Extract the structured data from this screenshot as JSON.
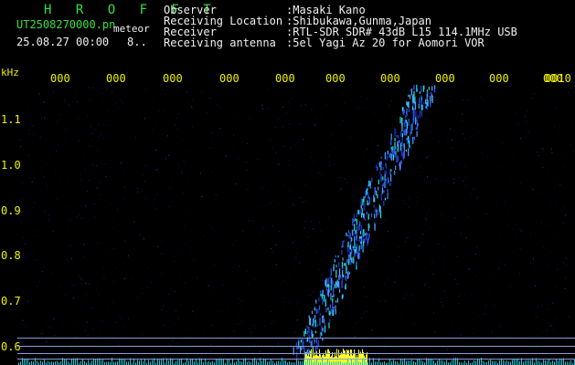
{
  "header": {
    "app_title": "H R O F F T",
    "filename": "UT2508270000.pn",
    "tag": "meteor",
    "datetime": "25.08.27 00:00",
    "counter": "8..",
    "fields": [
      {
        "label": "Observer",
        "value": ":Masaki Kano"
      },
      {
        "label": "Receiving Location",
        "value": ":Shibukawa,Gunma,Japan"
      },
      {
        "label": "Receiver",
        "value": ":RTL-SDR SDR# 43dB L15 114.1MHz USB"
      },
      {
        "label": "Receiving antenna",
        "value": ":5el Yagi Az 20 for Aomori VOR"
      }
    ]
  },
  "axes": {
    "y_unit": "kHz",
    "y_ticks": [
      "1.1",
      "1.0",
      "0.9",
      "0.8",
      "0.7",
      "0.6"
    ],
    "x_ticks": [
      "000",
      "000",
      "000",
      "000",
      "000",
      "000",
      "000",
      "000",
      "000",
      "000",
      "0010"
    ]
  },
  "colors": {
    "background": "#000000",
    "label_yellow": "#f0f000",
    "title_green": "#35e040",
    "trace_blue": "#2a5cff",
    "trace_cyan": "#20e0e0",
    "echo_yellow": "#ffff20"
  }
}
